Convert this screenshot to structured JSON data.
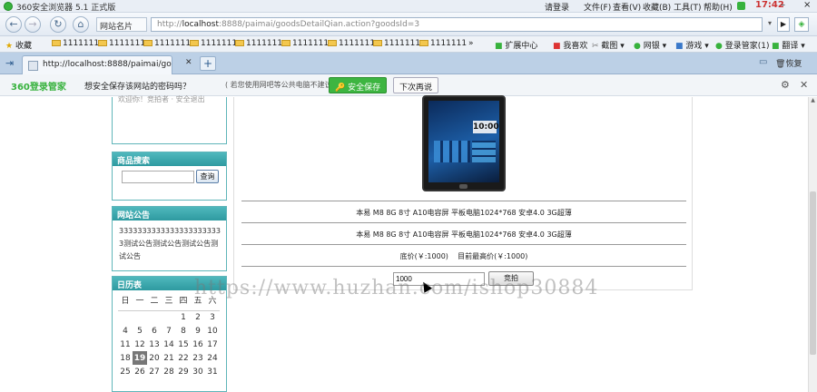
{
  "window": {
    "title": "360安全浏览器 5.1 正式版"
  },
  "menu": [
    "请登录",
    "文件(F)",
    "查看(V)",
    "收藏(B)",
    "工具(T)",
    "帮助(H)"
  ],
  "clock": "17:42",
  "address": {
    "site_name": "网站名片",
    "url_prefix": "http://",
    "url_host": "localhost",
    "url_rest": ":8888/paimai/goodsDetailQian.action?goodsId=3"
  },
  "favorites": {
    "label": "收藏",
    "folders": [
      "1111111",
      "1111111",
      "1111111",
      "1111111",
      "1111111",
      "1111111",
      "1111111",
      "1111111",
      "1111111"
    ],
    "tools": [
      "扩展中心",
      "我喜欢",
      "截图",
      "网银",
      "游戏",
      "登录管家(1)",
      "翻译"
    ]
  },
  "tab": {
    "title": "http://localhost:8888/paimai/go...",
    "restore": "恢复"
  },
  "password_bar": {
    "brand": "360登录管家",
    "prompt": "想安全保存该网站的密码吗？",
    "note": "( 若您使用网吧等公共电脑不建议保存 )",
    "save_label": "安全保存",
    "later_label": "下次再说"
  },
  "sidebar": {
    "top_text": "欢迎你！竞拍者 · 安全退出",
    "search": {
      "title": "商品搜索",
      "button": "查询",
      "value": ""
    },
    "notice": {
      "title": "网站公告",
      "text": "33333333333333333333333测试公告测试公告测试公告测试公告"
    },
    "calendar": {
      "title": "日历表",
      "weekdays": [
        "日",
        "一",
        "二",
        "三",
        "四",
        "五",
        "六"
      ],
      "today": "19",
      "weeks": [
        [
          "",
          "",
          "",
          "",
          "1",
          "2",
          "3"
        ],
        [
          "4",
          "5",
          "6",
          "7",
          "8",
          "9",
          "10"
        ],
        [
          "11",
          "12",
          "13",
          "14",
          "15",
          "16",
          "17"
        ],
        [
          "18",
          "19",
          "20",
          "21",
          "22",
          "23",
          "24"
        ],
        [
          "25",
          "26",
          "27",
          "28",
          "29",
          "30",
          "31"
        ]
      ]
    }
  },
  "product": {
    "tablet_time": "10:00",
    "title": "本易  M8 8G 8寸  A10电容屏  平板电脑1024*768 安卓4.0 3G超薄",
    "desc": "本易  M8 8G 8寸  A10电容屏  平板电脑1024*768 安卓4.0 3G超薄",
    "prices": "底价(￥:1000)    目前最高价(￥:1000)",
    "bid_value": "1000",
    "bid_button": "竞拍"
  },
  "watermark": "https://www.huzhan.com/ishop30884",
  "colors": {
    "accent_green": "#37b23d",
    "panel_teal": "#3aa7ac"
  }
}
